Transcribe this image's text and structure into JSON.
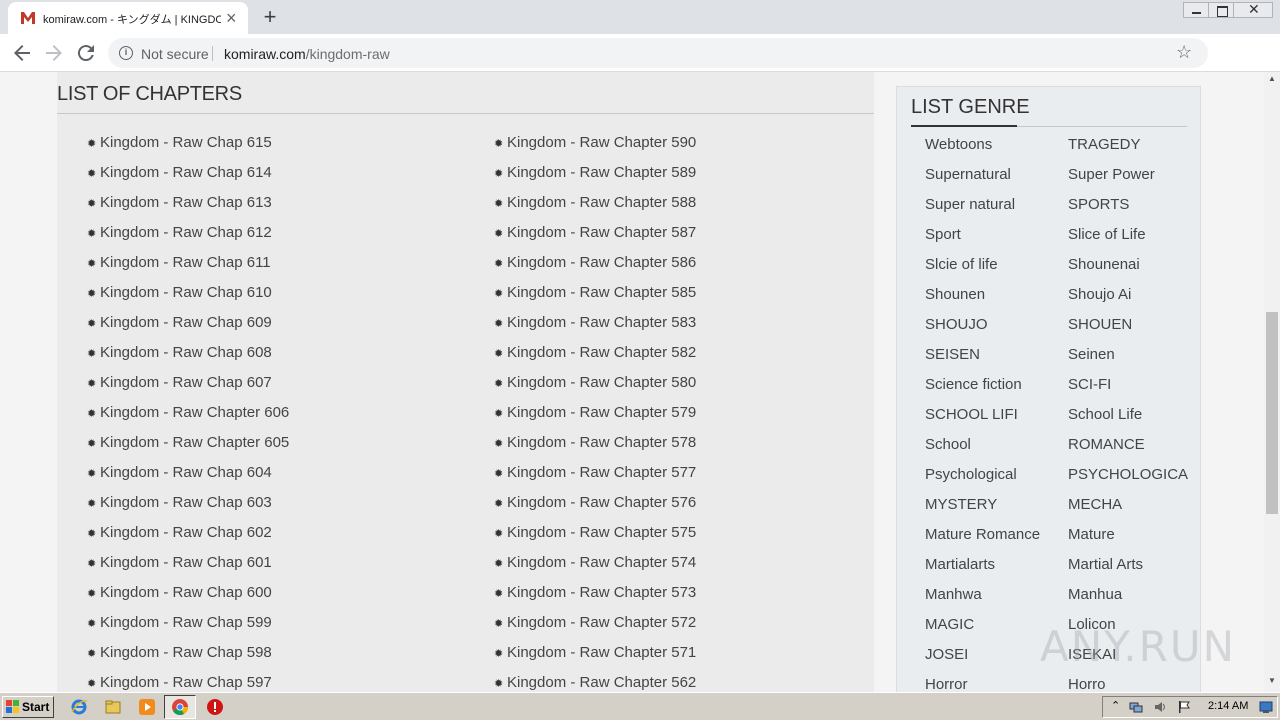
{
  "browser": {
    "tab_title": "komiraw.com - キングダム | KINGDOM",
    "tab_close": "×",
    "new_tab": "+",
    "security_label": "Not secure",
    "url_host": "komiraw.com",
    "url_path": "/kingdom-raw"
  },
  "page": {
    "chapters_heading": "LIST OF CHAPTERS",
    "genre_heading": "LIST GENRE",
    "chapters_left": [
      "Kingdom - Raw Chap 615",
      "Kingdom - Raw Chap 614",
      "Kingdom - Raw Chap 613",
      "Kingdom - Raw Chap 612",
      "Kingdom - Raw Chap 611",
      "Kingdom - Raw Chap 610",
      "Kingdom - Raw Chap 609",
      "Kingdom - Raw Chap 608",
      "Kingdom - Raw Chap 607",
      "Kingdom - Raw Chapter 606",
      "Kingdom - Raw Chapter 605",
      "Kingdom - Raw Chap 604",
      "Kingdom - Raw Chap 603",
      "Kingdom - Raw Chap 602",
      "Kingdom - Raw Chap 601",
      "Kingdom - Raw Chap 600",
      "Kingdom - Raw Chap 599",
      "Kingdom - Raw Chap 598",
      "Kingdom - Raw Chap 597"
    ],
    "chapters_right": [
      "Kingdom - Raw Chapter 590",
      "Kingdom - Raw Chapter 589",
      "Kingdom - Raw Chapter 588",
      "Kingdom - Raw Chapter 587",
      "Kingdom - Raw Chapter 586",
      "Kingdom - Raw Chapter 585",
      "Kingdom - Raw Chapter 583",
      "Kingdom - Raw Chapter 582",
      "Kingdom - Raw Chapter 580",
      "Kingdom - Raw Chapter 579",
      "Kingdom - Raw Chapter 578",
      "Kingdom - Raw Chapter 577",
      "Kingdom - Raw Chapter 576",
      "Kingdom - Raw Chapter 575",
      "Kingdom - Raw Chapter 574",
      "Kingdom - Raw Chapter 573",
      "Kingdom - Raw Chapter 572",
      "Kingdom - Raw Chapter 571",
      "Kingdom - Raw Chapter 562"
    ],
    "genres_left": [
      "Webtoons",
      "Supernatural",
      "Super natural",
      "Sport",
      "Slcie of life",
      "Shounen",
      "SHOUJO",
      "SEISEN",
      "Science fiction",
      "SCHOOL LIFI",
      "School",
      "Psychological",
      "MYSTERY",
      "Mature Romance",
      "Martialarts",
      "Manhwa",
      "MAGIC",
      "JOSEI",
      "Horror"
    ],
    "genres_right": [
      "TRAGEDY",
      "Super Power",
      "SPORTS",
      "Slice of Life",
      "Shounenai",
      "Shoujo Ai",
      "SHOUEN",
      "Seinen",
      "SCI-FI",
      "School Life",
      "ROMANCE",
      "PSYCHOLOGICA",
      "MECHA",
      "Mature",
      "Martial Arts",
      "Manhua",
      "Lolicon",
      "ISEKAI",
      "Horro"
    ],
    "watermark": "ANY.RUN"
  },
  "taskbar": {
    "start_label": "Start",
    "clock": "2:14 AM"
  },
  "icons": {
    "favicon": "komiraw-favicon-icon",
    "back": "back-arrow-icon",
    "forward": "forward-arrow-icon",
    "reload": "reload-icon",
    "info": "info-icon",
    "star": "star-icon",
    "profile": "profile-icon",
    "menu": "menu-kebab-icon",
    "bullet": "bullet-icon"
  },
  "colors": {
    "favicon_red": "#c0392b",
    "panel_bg": "#ebebeb",
    "genre_bg": "#e9edf0",
    "text": "#444444"
  }
}
